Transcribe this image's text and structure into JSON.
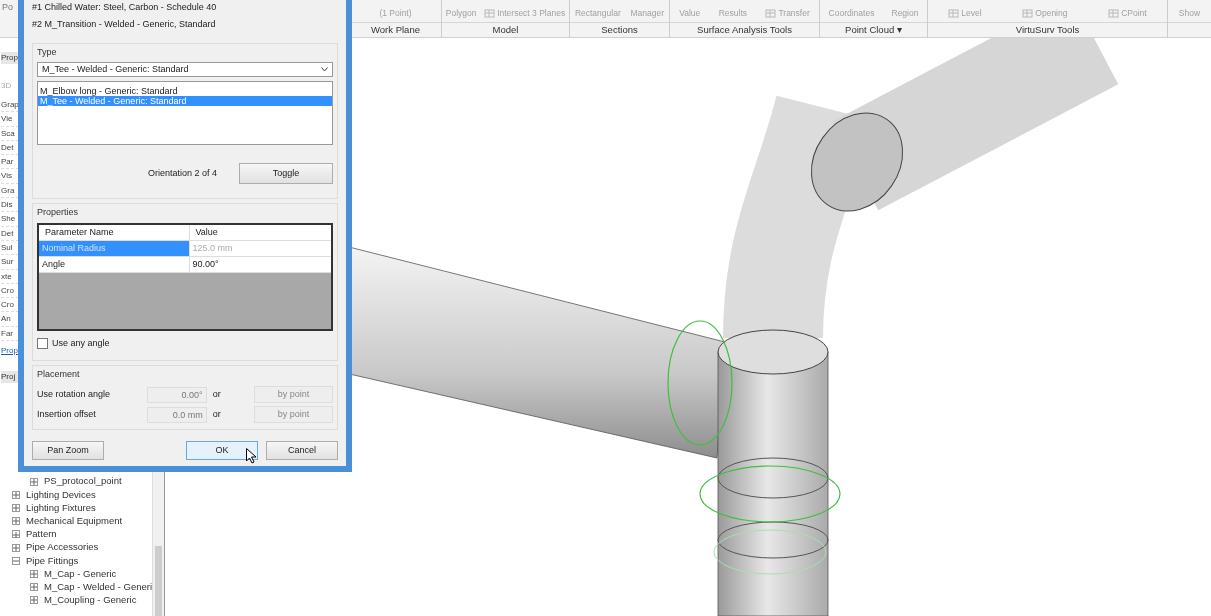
{
  "ribbon": {
    "fragment": "Po",
    "panels": [
      {
        "label": "Work Plane",
        "tools": [
          {
            "label": "(1 Point)",
            "kind": "text"
          }
        ]
      },
      {
        "label": "Model",
        "tools": [
          {
            "label": "Polygon",
            "kind": "text"
          },
          {
            "label": "Intersect 3 Planes",
            "kind": "icon"
          }
        ]
      },
      {
        "label": "Sections",
        "tools": [
          {
            "label": "Rectangular",
            "kind": "text"
          },
          {
            "label": "Manager",
            "kind": "text"
          }
        ]
      },
      {
        "label": "Surface Analysis Tools",
        "tools": [
          {
            "label": "Value",
            "kind": "text"
          },
          {
            "label": "Results",
            "kind": "text"
          },
          {
            "label": "Transfer",
            "kind": "icon"
          }
        ]
      },
      {
        "label": "Point Cloud ▾",
        "tools": [
          {
            "label": "Coordinates",
            "kind": "text"
          },
          {
            "label": "Region",
            "kind": "text"
          }
        ]
      },
      {
        "label": "VirtuSurv Tools",
        "tools": [
          {
            "label": "Level",
            "kind": "icon"
          },
          {
            "label": "Opening",
            "kind": "icon"
          },
          {
            "label": "CPoint",
            "kind": "icon"
          }
        ]
      },
      {
        "tools": [
          {
            "label": "Show",
            "kind": "text"
          }
        ]
      }
    ]
  },
  "properties_strip": [
    {
      "text": "Prop",
      "kind": "tab"
    },
    {
      "text": "3D",
      "kind": "view"
    },
    {
      "text": "Grap",
      "kind": "row"
    },
    {
      "text": "Vie",
      "kind": "row"
    },
    {
      "text": "Sca",
      "kind": "row"
    },
    {
      "text": "Det",
      "kind": "row"
    },
    {
      "text": "Par",
      "kind": "row"
    },
    {
      "text": "Vis",
      "kind": "row"
    },
    {
      "text": "Gra",
      "kind": "row"
    },
    {
      "text": "Dis",
      "kind": "row"
    },
    {
      "text": "She",
      "kind": "row"
    },
    {
      "text": "Det",
      "kind": "row"
    },
    {
      "text": "Sul",
      "kind": "row"
    },
    {
      "text": "Sur",
      "kind": "row"
    },
    {
      "text": "xte",
      "kind": "row"
    },
    {
      "text": "Cro",
      "kind": "row"
    },
    {
      "text": "Cro",
      "kind": "row"
    },
    {
      "text": "An",
      "kind": "row"
    },
    {
      "text": "Far",
      "kind": "row"
    },
    {
      "text": "Prop",
      "kind": "link"
    },
    {
      "text": "Proj",
      "kind": "tab"
    }
  ],
  "project_browser": {
    "items": [
      {
        "children": [
          {
            "label": "PS_protocol_point",
            "expanded": false
          }
        ]
      },
      {
        "label": "Lighting Devices",
        "expanded": false
      },
      {
        "label": "Lighting Fixtures",
        "expanded": false
      },
      {
        "label": "Mechanical Equipment",
        "expanded": false
      },
      {
        "label": "Pattern",
        "expanded": false
      },
      {
        "label": "Pipe Accessories",
        "expanded": false
      },
      {
        "label": "Pipe Fittings",
        "expanded": true,
        "children": [
          {
            "label": "M_Cap - Generic",
            "expanded": false
          },
          {
            "label": "M_Cap - Welded - Generi",
            "expanded": false
          },
          {
            "label": "M_Coupling - Generic",
            "expanded": false
          }
        ]
      }
    ]
  },
  "dialog": {
    "connections": [
      "#1 Chilled Water: Steel, Carbon - Schedule 40",
      "#2 M_Transition - Welded - Generic, Standard"
    ],
    "type_group": {
      "label": "Type",
      "value": "M_Tee - Welded - Generic: Standard",
      "options": [
        {
          "label": "M_Elbow long - Generic: Standard",
          "selected": false
        },
        {
          "label": "M_Tee - Welded - Generic: Standard",
          "selected": true
        }
      ]
    },
    "orientation": "Orientation 2 of 4",
    "toggle": "Toggle",
    "properties": {
      "label": "Properties",
      "columns": [
        "Parameter Name",
        "Value"
      ],
      "rows": [
        {
          "name": "Nominal Radius",
          "value": "125.0 mm",
          "selected": true,
          "disabled": true
        },
        {
          "name": "Angle",
          "value": "90.00°",
          "selected": false,
          "disabled": false
        }
      ]
    },
    "use_any_angle": {
      "label": "Use any angle",
      "checked": false
    },
    "placement": {
      "label": "Placement",
      "rows": [
        {
          "label": "Use rotation angle",
          "value": "0.00°",
          "or": "or",
          "button": "by point",
          "disabled": true
        },
        {
          "label": "Insertion offset",
          "value": "0.0 mm",
          "or": "or",
          "button": "by point",
          "disabled": true
        }
      ]
    },
    "buttons": [
      {
        "label": "Pan Zoom",
        "kind": "left"
      },
      {
        "label": "OK",
        "kind": "default"
      },
      {
        "label": "Cancel",
        "kind": "right"
      }
    ]
  }
}
